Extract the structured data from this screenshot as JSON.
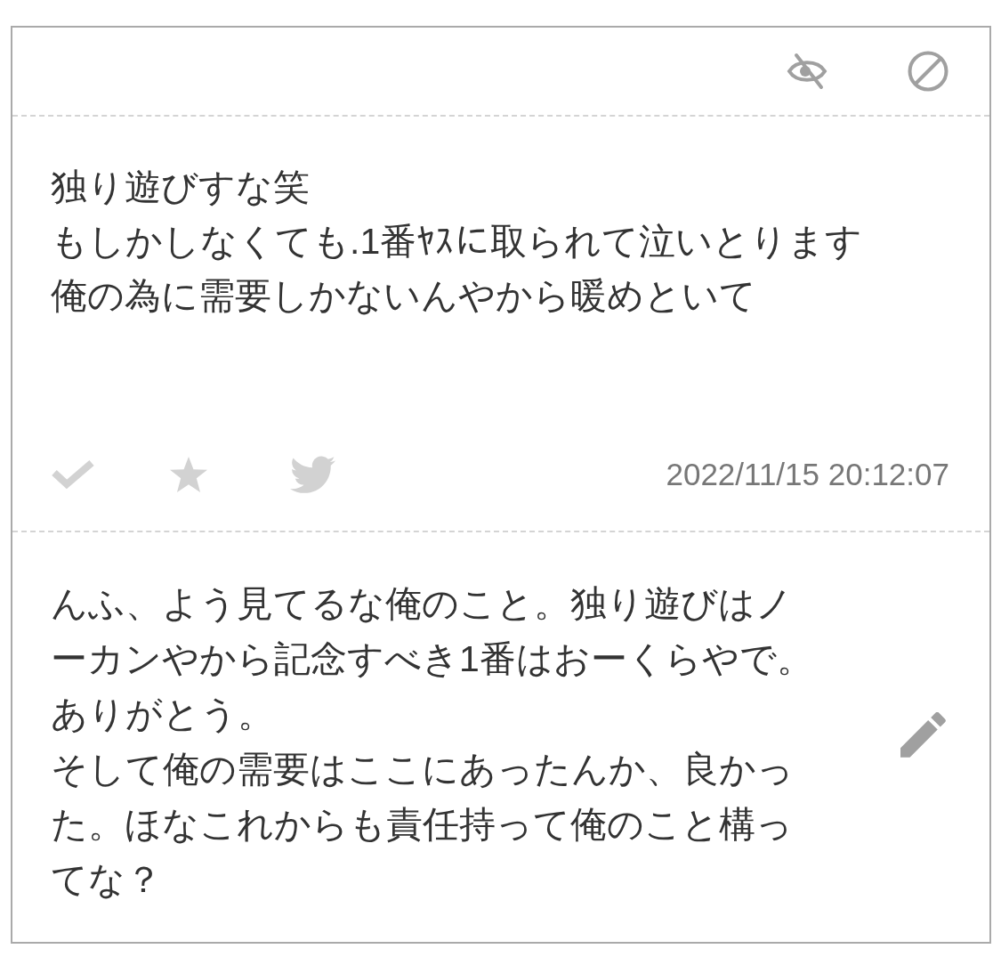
{
  "message": {
    "lines": [
      "独り遊びすな笑",
      "もしかしなくても.1番ﾔｽに取られて泣いとります",
      "俺の為に需要しかないんやから暖めといて"
    ],
    "timestamp": "2022/11/15 20:12:07"
  },
  "reply": {
    "paragraphs": [
      "んふ、よう見てるな俺のこと。独り遊びはノーカンやから記念すべき1番はおーくらやで。",
      "ありがとう。",
      "そして俺の需要はここにあったんか、良かった。ほなこれからも責任持って俺のこと構ってな？"
    ]
  }
}
